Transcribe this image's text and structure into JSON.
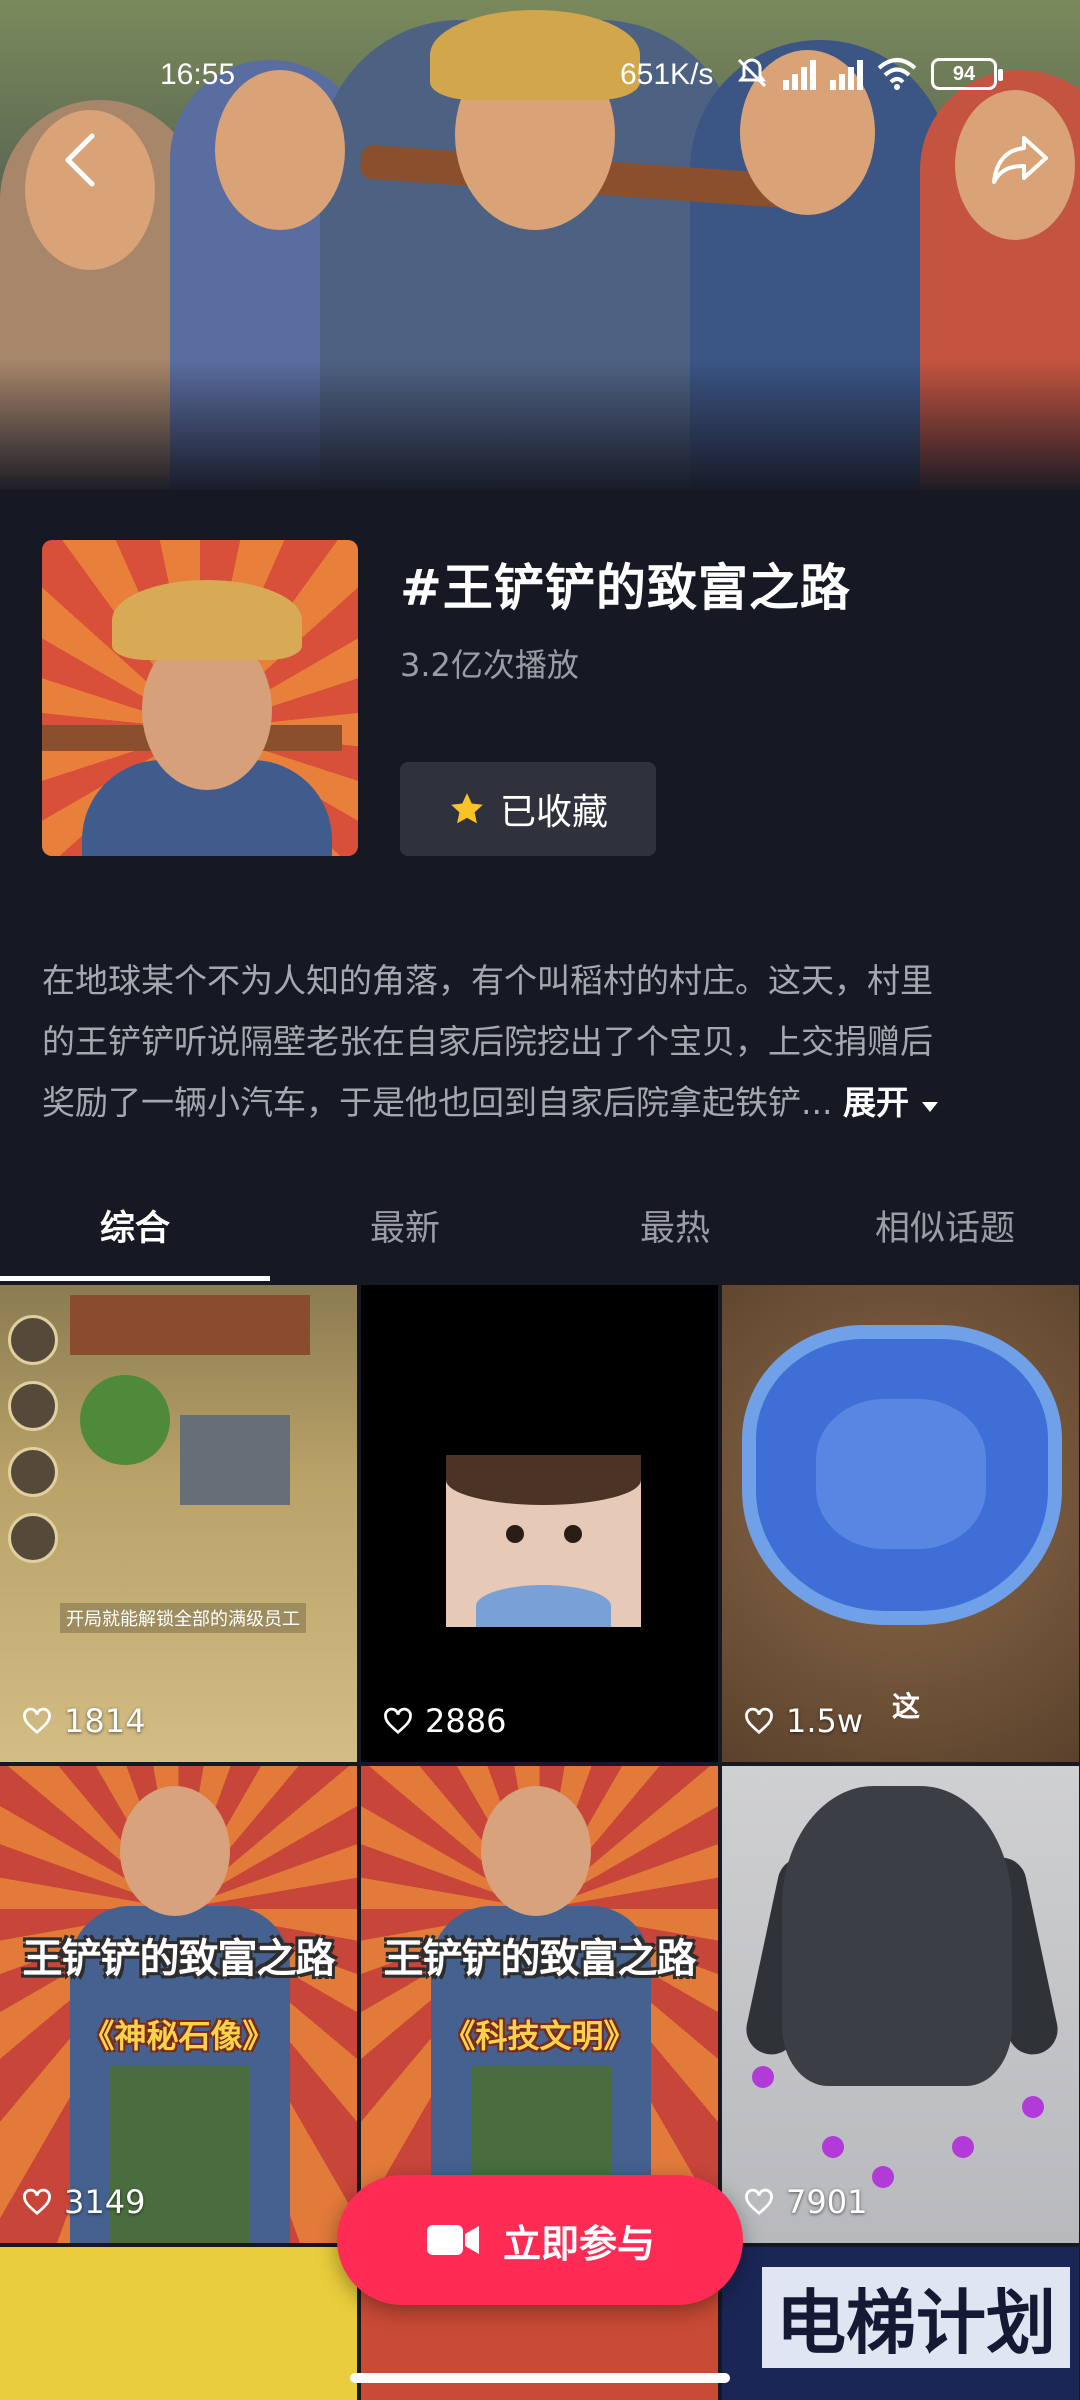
{
  "status_bar": {
    "time": "16:55",
    "net_speed": "651K/s",
    "battery": "94"
  },
  "topic": {
    "title": "#王铲铲的致富之路",
    "plays": "3.2亿次播放",
    "favorite_label": "已收藏",
    "description_lines": [
      "在地球某个不为人知的角落，有个叫稻村的村庄。这天，村里",
      "的王铲铲听说隔壁老张在自家后院挖出了个宝贝，上交捐赠后",
      "奖励了一辆小汽车，于是他也回到自家后院拿起铁铲..."
    ],
    "expand_label": "展开"
  },
  "tabs": [
    {
      "label": "综合",
      "active": true
    },
    {
      "label": "最新",
      "active": false
    },
    {
      "label": "最热",
      "active": false
    },
    {
      "label": "相似话题",
      "active": false
    }
  ],
  "videos": [
    {
      "likes": "1814",
      "caption": "开局就能解锁全部的满级员工"
    },
    {
      "likes": "2886"
    },
    {
      "likes": "1.5w",
      "overlay": "这"
    },
    {
      "likes": "3149",
      "poster_title": "王铲铲的致富之路",
      "poster_sub": "《神秘石像》"
    },
    {
      "likes": "",
      "poster_title": "王铲铲的致富之路",
      "poster_sub": "《科技文明》"
    },
    {
      "likes": "7901"
    },
    {},
    {},
    {
      "overlay": "电梯计划"
    }
  ],
  "join_button": {
    "label": "立即参与"
  },
  "colors": {
    "background": "#161823",
    "accent": "#fe2c55",
    "star": "#f7c325"
  }
}
